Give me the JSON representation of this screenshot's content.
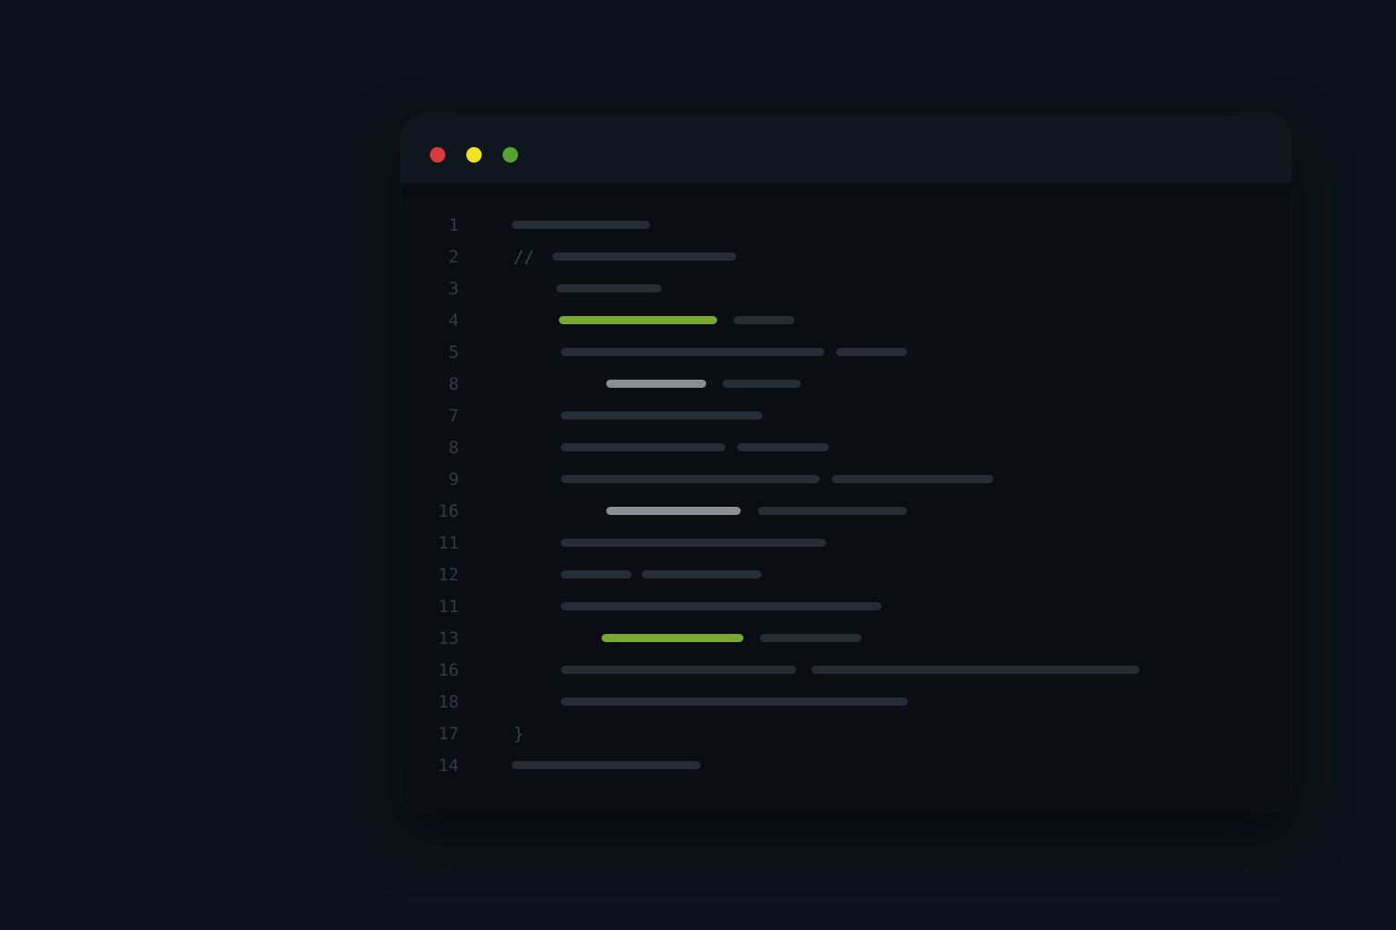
{
  "window": {
    "controls": {
      "close_color": "#d83a3a",
      "minimize_color": "#f2e21b",
      "maximize_color": "#55a432"
    }
  },
  "editor": {
    "token_colors": {
      "default": "#252c33",
      "green": "#79a932",
      "light": "#8a8f95"
    },
    "lines": [
      {
        "number": "1"
      },
      {
        "number": "2",
        "glyph": "//"
      },
      {
        "number": "3"
      },
      {
        "number": "4"
      },
      {
        "number": "5"
      },
      {
        "number": "8"
      },
      {
        "number": "7"
      },
      {
        "number": "8"
      },
      {
        "number": "9"
      },
      {
        "number": "16"
      },
      {
        "number": "11"
      },
      {
        "number": "12"
      },
      {
        "number": "11"
      },
      {
        "number": "13"
      },
      {
        "number": "16"
      },
      {
        "number": "18"
      },
      {
        "number": "17",
        "glyph": "}"
      },
      {
        "number": "14"
      }
    ]
  }
}
